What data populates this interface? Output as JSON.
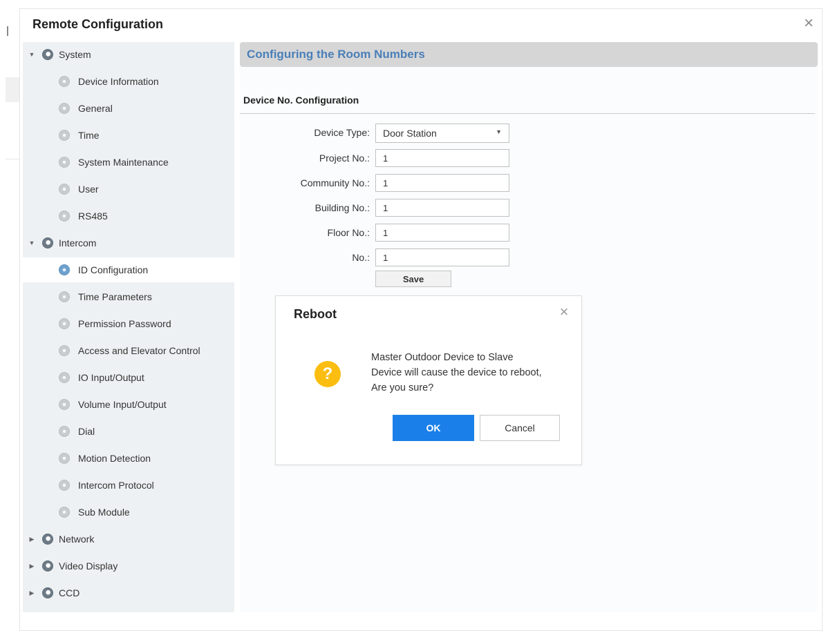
{
  "window": {
    "title": "Remote Configuration",
    "close_icon": "close-icon"
  },
  "sidebar": {
    "system": {
      "label": "System",
      "items": [
        {
          "label": "Device Information"
        },
        {
          "label": "General"
        },
        {
          "label": "Time"
        },
        {
          "label": "System Maintenance"
        },
        {
          "label": "User"
        },
        {
          "label": "RS485"
        }
      ]
    },
    "intercom": {
      "label": "Intercom",
      "items": [
        {
          "label": "ID Configuration",
          "selected": true
        },
        {
          "label": "Time Parameters"
        },
        {
          "label": "Permission Password"
        },
        {
          "label": "Access and Elevator Control"
        },
        {
          "label": "IO Input/Output"
        },
        {
          "label": "Volume Input/Output"
        },
        {
          "label": "Dial"
        },
        {
          "label": "Motion Detection"
        },
        {
          "label": "Intercom Protocol"
        },
        {
          "label": "Sub Module"
        }
      ]
    },
    "network": {
      "label": "Network"
    },
    "video_display": {
      "label": "Video Display"
    },
    "ccd": {
      "label": "CCD"
    }
  },
  "main": {
    "header": "Configuring the Room Numbers",
    "section_title": "Device No. Configuration",
    "form": {
      "device_type": {
        "label": "Device Type:",
        "value": "Door Station"
      },
      "project_no": {
        "label": "Project No.:",
        "value": "1"
      },
      "community_no": {
        "label": "Community No.:",
        "value": "1"
      },
      "building_no": {
        "label": "Building No.:",
        "value": "1"
      },
      "floor_no": {
        "label": "Floor No.:",
        "value": "1"
      },
      "no": {
        "label": "No.:",
        "value": "1"
      },
      "save_label": "Save"
    }
  },
  "dialog": {
    "title": "Reboot",
    "message_lines": [
      "Master Outdoor Device to Slave",
      "Device will cause the device to reboot,",
      "Are you sure?"
    ],
    "icon_glyph": "?",
    "ok_label": "OK",
    "cancel_label": "Cancel"
  },
  "colors": {
    "accent": "#1a7fe8",
    "header_text": "#4a7fb8",
    "warning": "#fbbd10",
    "sidebar_bg": "#eef1f3"
  }
}
